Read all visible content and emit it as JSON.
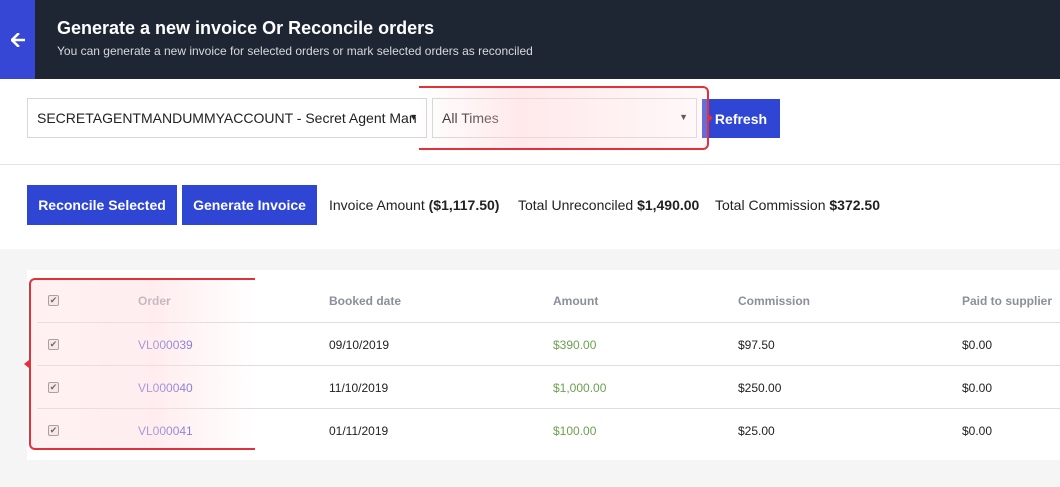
{
  "header": {
    "title": "Generate a new invoice Or Reconcile orders",
    "subtitle": "You can generate a new invoice for selected orders or mark selected orders as reconciled",
    "back_icon": "arrow-left-icon"
  },
  "filters": {
    "account_selected": "SECRETAGENTMANDUMMYACCOUNT - Secret Agent Man",
    "time_selected": "All Times",
    "caret": "▼",
    "refresh_label": "Refresh"
  },
  "actions": {
    "reconcile_label": "Reconcile Selected",
    "invoice_label": "Generate Invoice",
    "invoice_amount_label": "Invoice Amount",
    "invoice_amount_value": "($1,117.50)",
    "total_unreconciled_label": "Total Unreconciled",
    "total_unreconciled_value": "$1,490.00",
    "total_commission_label": "Total Commission",
    "total_commission_value": "$372.50"
  },
  "table": {
    "select_all_checked": true,
    "columns": [
      "Order",
      "Booked date",
      "Amount",
      "Commission",
      "Paid to supplier"
    ],
    "rows": [
      {
        "checked": true,
        "order": "VL000039",
        "booked_date": "09/10/2019",
        "amount": "$390.00",
        "commission": "$97.50",
        "paid_to_supplier": "$0.00"
      },
      {
        "checked": true,
        "order": "VL000040",
        "booked_date": "11/10/2019",
        "amount": "$1,000.00",
        "commission": "$250.00",
        "paid_to_supplier": "$0.00"
      },
      {
        "checked": true,
        "order": "VL000041",
        "booked_date": "01/11/2019",
        "amount": "$100.00",
        "commission": "$25.00",
        "paid_to_supplier": "$0.00"
      }
    ]
  },
  "colors": {
    "header_bg": "#1f2633",
    "accent": "#2f45d4",
    "link": "#4b48d6",
    "amount_green": "#6aa24f",
    "annotation_red": "#e2303c"
  }
}
